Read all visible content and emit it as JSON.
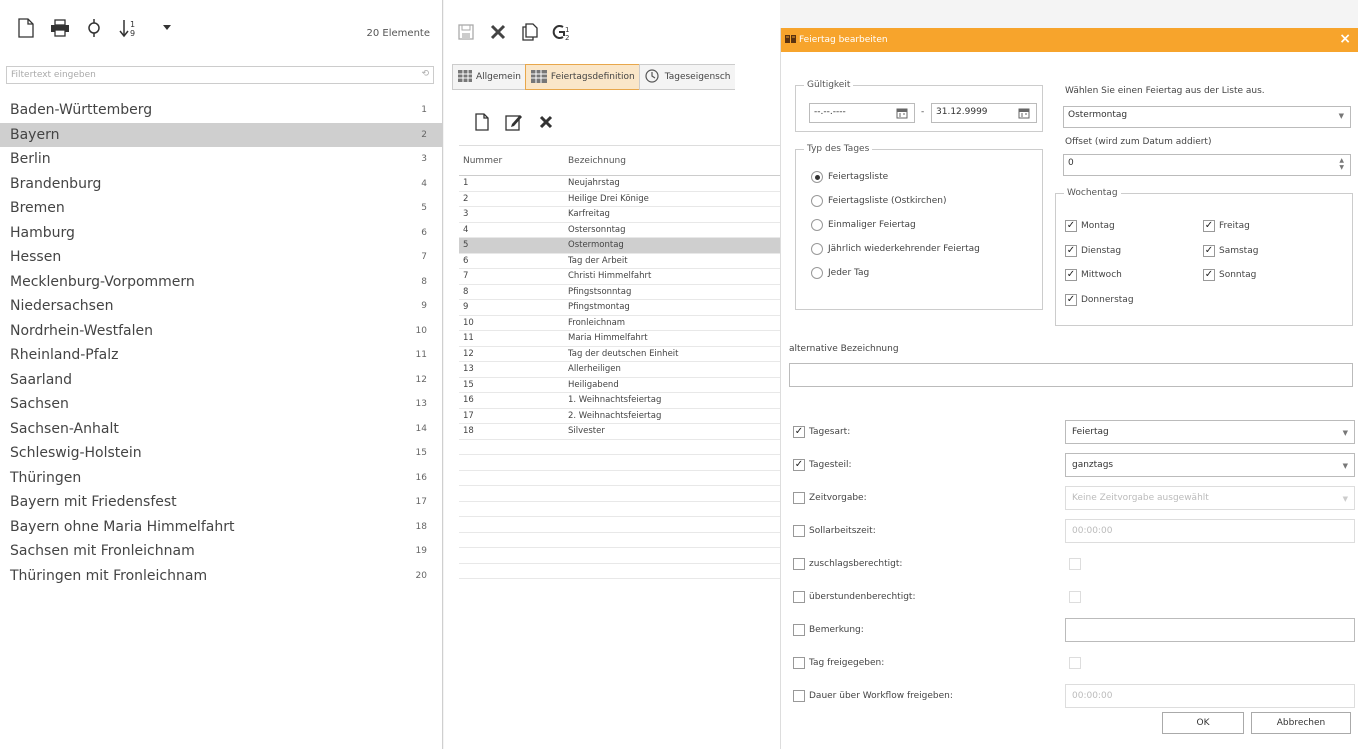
{
  "left": {
    "count_label": "20 Elemente",
    "filter_placeholder": "Filtertext eingeben",
    "states": [
      {
        "name": "Baden-Württemberg",
        "num": "1"
      },
      {
        "name": "Bayern",
        "num": "2"
      },
      {
        "name": "Berlin",
        "num": "3"
      },
      {
        "name": "Brandenburg",
        "num": "4"
      },
      {
        "name": "Bremen",
        "num": "5"
      },
      {
        "name": "Hamburg",
        "num": "6"
      },
      {
        "name": "Hessen",
        "num": "7"
      },
      {
        "name": "Mecklenburg-Vorpommern",
        "num": "8"
      },
      {
        "name": "Niedersachsen",
        "num": "9"
      },
      {
        "name": "Nordrhein-Westfalen",
        "num": "10"
      },
      {
        "name": "Rheinland-Pfalz",
        "num": "11"
      },
      {
        "name": "Saarland",
        "num": "12"
      },
      {
        "name": "Sachsen",
        "num": "13"
      },
      {
        "name": "Sachsen-Anhalt",
        "num": "14"
      },
      {
        "name": "Schleswig-Holstein",
        "num": "15"
      },
      {
        "name": "Thüringen",
        "num": "16"
      },
      {
        "name": "Bayern mit Friedensfest",
        "num": "17"
      },
      {
        "name": "Bayern ohne Maria Himmelfahrt",
        "num": "18"
      },
      {
        "name": "Sachsen mit Fronleichnam",
        "num": "19"
      },
      {
        "name": "Thüringen mit Fronleichnam",
        "num": "20"
      }
    ],
    "selected_index": 1
  },
  "middle": {
    "tabs": [
      "Allgemein",
      "Feiertagsdefinition",
      "Tageseigensch"
    ],
    "active_tab": 1,
    "columns": [
      "Nummer",
      "Bezeichnung"
    ],
    "rows": [
      {
        "num": "1",
        "name": "Neujahrstag"
      },
      {
        "num": "2",
        "name": "Heilige Drei Könige"
      },
      {
        "num": "3",
        "name": "Karfreitag"
      },
      {
        "num": "4",
        "name": "Ostersonntag"
      },
      {
        "num": "5",
        "name": "Ostermontag"
      },
      {
        "num": "6",
        "name": "Tag der Arbeit"
      },
      {
        "num": "7",
        "name": "Christi Himmelfahrt"
      },
      {
        "num": "8",
        "name": "Pfingstsonntag"
      },
      {
        "num": "9",
        "name": "Pfingstmontag"
      },
      {
        "num": "10",
        "name": "Fronleichnam"
      },
      {
        "num": "11",
        "name": "Maria Himmelfahrt"
      },
      {
        "num": "12",
        "name": "Tag der deutschen Einheit"
      },
      {
        "num": "13",
        "name": "Allerheiligen"
      },
      {
        "num": "15",
        "name": "Heiligabend"
      },
      {
        "num": "16",
        "name": "1. Weihnachtsfeiertag"
      },
      {
        "num": "17",
        "name": "2. Weihnachtsfeiertag"
      },
      {
        "num": "18",
        "name": "Silvester"
      }
    ],
    "selected_index": 4
  },
  "dialog": {
    "title": "Feiertag bearbeiten",
    "close": "×",
    "validity_legend": "Gültigkeit",
    "date_from": "--.--.----",
    "date_sep": "-",
    "date_to": "31.12.9999",
    "day_type_legend": "Typ des Tages",
    "day_types": [
      "Feiertagsliste",
      "Feiertagsliste (Ostkirchen)",
      "Einmaliger Feiertag",
      "Jährlich wiederkehrender Feiertag",
      "Jeder Tag"
    ],
    "day_type_selected": 0,
    "choose_label": "Wählen Sie einen Feiertag aus der Liste aus.",
    "holiday_value": "Ostermontag",
    "offset_label": "Offset (wird zum Datum addiert)",
    "offset_value": "0",
    "weekday_legend": "Wochentag",
    "weekdays_left": [
      "Montag",
      "Dienstag",
      "Mittwoch",
      "Donnerstag"
    ],
    "weekdays_right": [
      "Freitag",
      "Samstag",
      "Sonntag"
    ],
    "alt_label": "alternative Bezeichnung",
    "alt_value": "",
    "props": [
      {
        "label": "Tagesart:",
        "checked": true,
        "value": "Feiertag",
        "kind": "select"
      },
      {
        "label": "Tagesteil:",
        "checked": true,
        "value": "ganztags",
        "kind": "select"
      },
      {
        "label": "Zeitvorgabe:",
        "checked": false,
        "value": "Keine Zeitvorgabe ausgewählt",
        "kind": "select-disabled"
      },
      {
        "label": "Sollarbeitszeit:",
        "checked": false,
        "value": "00:00:00",
        "kind": "text-disabled"
      },
      {
        "label": "zuschlagsberechtigt:",
        "checked": false,
        "value": "",
        "kind": "check"
      },
      {
        "label": "überstundenberechtigt:",
        "checked": false,
        "value": "",
        "kind": "check"
      },
      {
        "label": "Bemerkung:",
        "checked": false,
        "value": "",
        "kind": "text"
      },
      {
        "label": "Tag freigegeben:",
        "checked": false,
        "value": "",
        "kind": "check"
      },
      {
        "label": "Dauer über Workflow freigeben:",
        "checked": false,
        "value": "00:00:00",
        "kind": "text-disabled"
      }
    ],
    "ok_label": "OK",
    "cancel_label": "Abbrechen"
  },
  "colors": {
    "accent": "#f7a42c",
    "selection": "#cfcfcf",
    "tab_active": "#fae6c8"
  }
}
